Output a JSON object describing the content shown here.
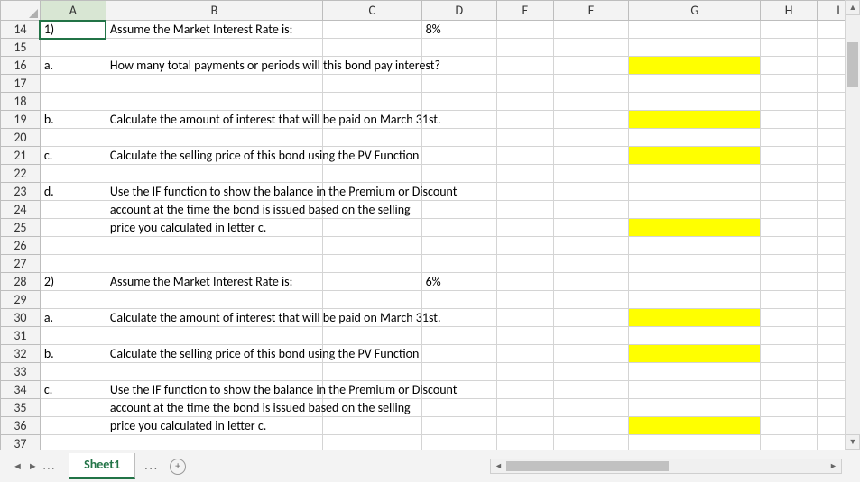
{
  "columns": [
    "A",
    "B",
    "C",
    "D",
    "E",
    "F",
    "G",
    "H",
    "I"
  ],
  "selected_column": "A",
  "active_cell": "A14",
  "rows": [
    {
      "n": 14,
      "A": "1)",
      "B": "Assume the Market Interest Rate is:",
      "B_bold": true,
      "D": "8%",
      "D_bold": true,
      "D_align": "right"
    },
    {
      "n": 15
    },
    {
      "n": 16,
      "A": "a.",
      "B": "How many total payments or periods will this bond pay interest?",
      "G_yellow": true
    },
    {
      "n": 17
    },
    {
      "n": 18
    },
    {
      "n": 19,
      "A": "b.",
      "B": "Calculate the amount of interest that will be paid on March 31st.",
      "G_yellow": true
    },
    {
      "n": 20
    },
    {
      "n": 21,
      "A": "c.",
      "B": "Calculate the selling price of this bond using the PV Function",
      "G_yellow": true
    },
    {
      "n": 22
    },
    {
      "n": 23,
      "A": "d.",
      "B": "Use the IF function to show the balance in the Premium or Discount"
    },
    {
      "n": 24,
      "B": "account at the time the bond is issued based on the selling"
    },
    {
      "n": 25,
      "B": "price you calculated in letter c.",
      "G_yellow": true
    },
    {
      "n": 26
    },
    {
      "n": 27
    },
    {
      "n": 28,
      "A": "2)",
      "B": "Assume the Market Interest Rate is:",
      "B_bold": true,
      "D": "6%",
      "D_bold": true,
      "D_align": "right"
    },
    {
      "n": 29
    },
    {
      "n": 30,
      "A": "a.",
      "B": "Calculate the amount of interest that will be paid on March 31st.",
      "G_yellow": true
    },
    {
      "n": 31
    },
    {
      "n": 32,
      "A": "b.",
      "B": "Calculate the selling price of this bond using the PV Function",
      "G_yellow": true
    },
    {
      "n": 33
    },
    {
      "n": 34,
      "A": "c.",
      "B": "Use the IF function to show the balance in the Premium or Discount"
    },
    {
      "n": 35,
      "B": "account at the time the bond is issued based on the selling"
    },
    {
      "n": 36,
      "B": "price you calculated in letter c.",
      "G_yellow": true
    },
    {
      "n": 37
    }
  ],
  "sheet_tab": "Sheet1"
}
